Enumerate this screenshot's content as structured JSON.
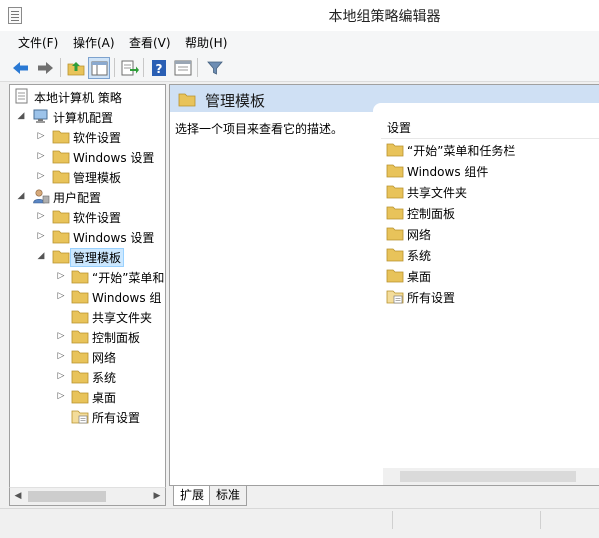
{
  "window": {
    "title": "本地组策略编辑器"
  },
  "menu": [
    {
      "label": "文件(F)"
    },
    {
      "label": "操作(A)"
    },
    {
      "label": "查看(V)"
    },
    {
      "label": "帮助(H)"
    }
  ],
  "toolbar": [
    {
      "icon": "back-arrow-icon"
    },
    {
      "icon": "forward-arrow-icon"
    },
    {
      "icon": "up-folder-icon"
    },
    {
      "icon": "show-hide-tree-icon"
    },
    {
      "icon": "export-list-icon"
    },
    {
      "icon": "help-icon"
    },
    {
      "icon": "properties-icon"
    },
    {
      "icon": "filter-icon"
    }
  ],
  "tree": {
    "root": "本地计算机 策略",
    "computer_config": "计算机配置",
    "cc_software": "软件设置",
    "cc_windows": "Windows 设置",
    "cc_admin": "管理模板",
    "user_config": "用户配置",
    "uc_software": "软件设置",
    "uc_windows": "Windows 设置",
    "uc_admin": "管理模板",
    "uc_admin_children": [
      "“开始”菜单和",
      "Windows 组",
      "共享文件夹",
      "控制面板",
      "网络",
      "系统",
      "桌面",
      "所有设置"
    ]
  },
  "content": {
    "title": "管理模板",
    "description": "选择一个项目来查看它的描述。",
    "column_header": "设置",
    "items": [
      "“开始”菜单和任务栏",
      "Windows 组件",
      "共享文件夹",
      "控制面板",
      "网络",
      "系统",
      "桌面",
      "所有设置"
    ]
  },
  "tabs": [
    {
      "label": "扩展"
    },
    {
      "label": "标准"
    }
  ],
  "colors": {
    "folder": "#e8c35a",
    "selection": "#cce8ff",
    "header_band": "#cfe0f4"
  }
}
